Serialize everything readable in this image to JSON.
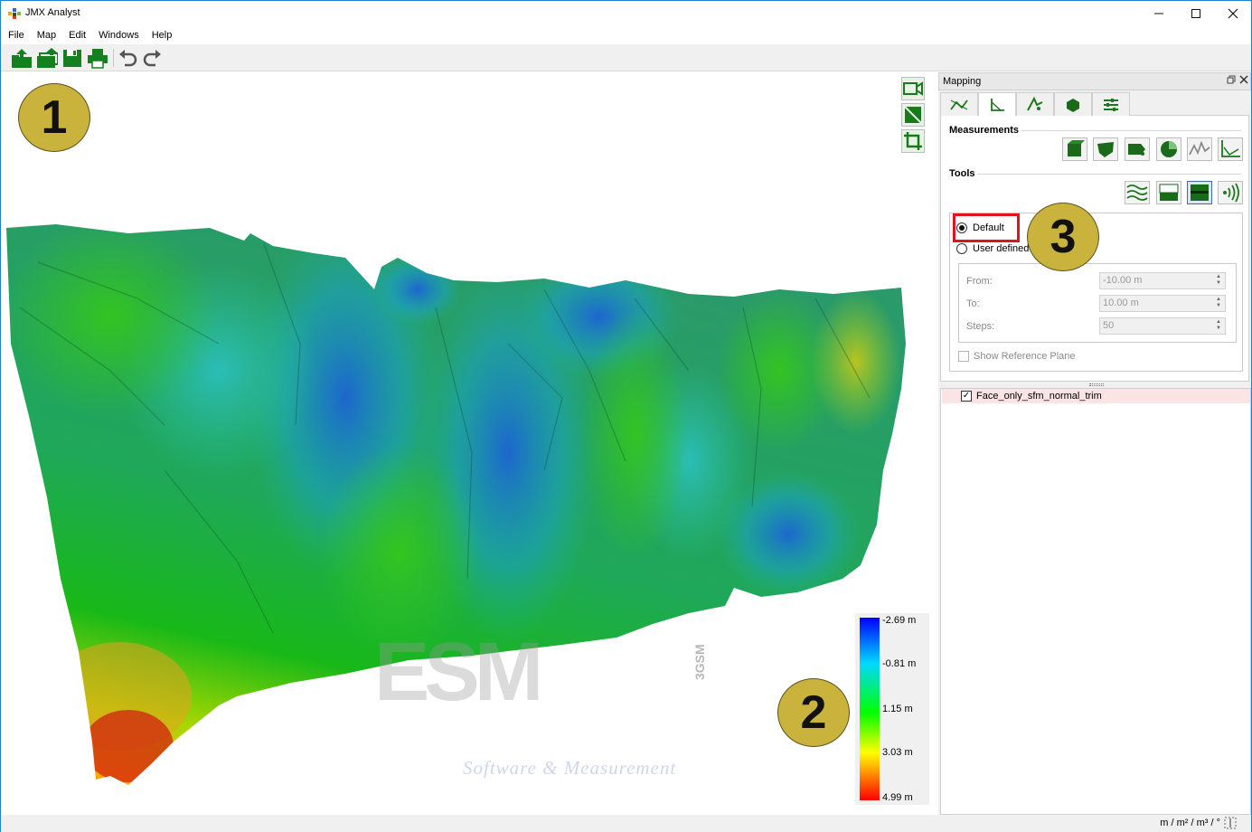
{
  "window": {
    "title": "JMX Analyst",
    "controls": [
      "minimize",
      "maximize",
      "close"
    ]
  },
  "menu": [
    "File",
    "Map",
    "Edit",
    "Windows",
    "Help"
  ],
  "toolbar": {
    "buttons": [
      "open-project-icon",
      "open-folder-icon",
      "save-icon",
      "print-icon",
      "undo-icon",
      "redo-icon"
    ]
  },
  "viewport": {
    "badges": {
      "one": "1",
      "two": "2",
      "three": "3"
    },
    "watermark": {
      "text": "Software & Measurement",
      "vertical_text": "3GSM"
    },
    "view_tools": [
      "camera-icon",
      "fit-view-icon",
      "crop-icon"
    ],
    "colorbar": {
      "labels": [
        "-2.69 m",
        "-0.81 m",
        "1.15 m",
        "3.03 m",
        "4.99 m"
      ],
      "colors": [
        "#0000ff",
        "#00d9ff",
        "#00ff00",
        "#ffff00",
        "#ff0000"
      ]
    }
  },
  "panel": {
    "title": "Mapping",
    "tabs": [
      "distance-icon",
      "angle-icon",
      "point-icon",
      "volume-icon",
      "settings-icon"
    ],
    "active_tab": 1,
    "measurements_title": "Measurements",
    "measurement_tools": [
      "box-icon",
      "polygon-icon",
      "area-icon",
      "pie-icon",
      "profile-icon",
      "angle-chart-icon"
    ],
    "tools_title": "Tools",
    "tools": [
      "contour-icon",
      "plane-icon",
      "distance-map-icon",
      "signal-icon"
    ],
    "tools_pressed": 2,
    "mode_default": "Default",
    "mode_user": "User defined",
    "from_label": "From:",
    "from_value": "-10.00 m",
    "to_label": "To:",
    "to_value": "10.00 m",
    "steps_label": "Steps:",
    "steps_value": "50",
    "show_plane_label": "Show Reference Plane",
    "layer_name": "Face_only_sfm_normal_trim"
  },
  "status": {
    "units": "m / m² / m³ / °"
  }
}
